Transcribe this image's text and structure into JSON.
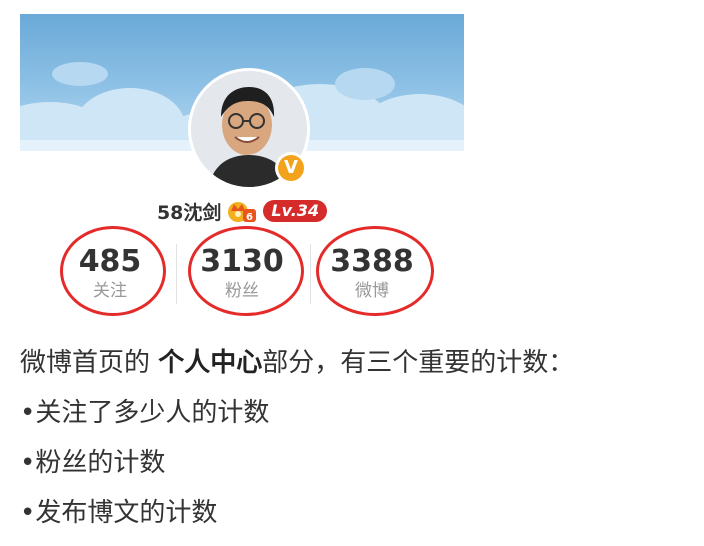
{
  "profile": {
    "username": "58沈剑",
    "verified_badge": "V",
    "level": "Lv.34",
    "crown_badge_number": "6",
    "icons": {
      "verified": "verified-v-icon",
      "crown": "crown-icon"
    },
    "stats": [
      {
        "count": "485",
        "label": "关注"
      },
      {
        "count": "3130",
        "label": "粉丝"
      },
      {
        "count": "3388",
        "label": "微博"
      }
    ],
    "colors": {
      "highlight_ellipse": "#e52a2a",
      "level_badge": "#d52b2b",
      "verified_badge": "#f2a21b"
    }
  },
  "explanation": {
    "intro_prefix": "微博首页的 ",
    "intro_bold": "个人中心",
    "intro_suffix": "部分，有三个重要的计数：",
    "bullets": [
      "•关注了多少人的计数",
      "•粉丝的计数",
      "•发布博文的计数"
    ]
  }
}
